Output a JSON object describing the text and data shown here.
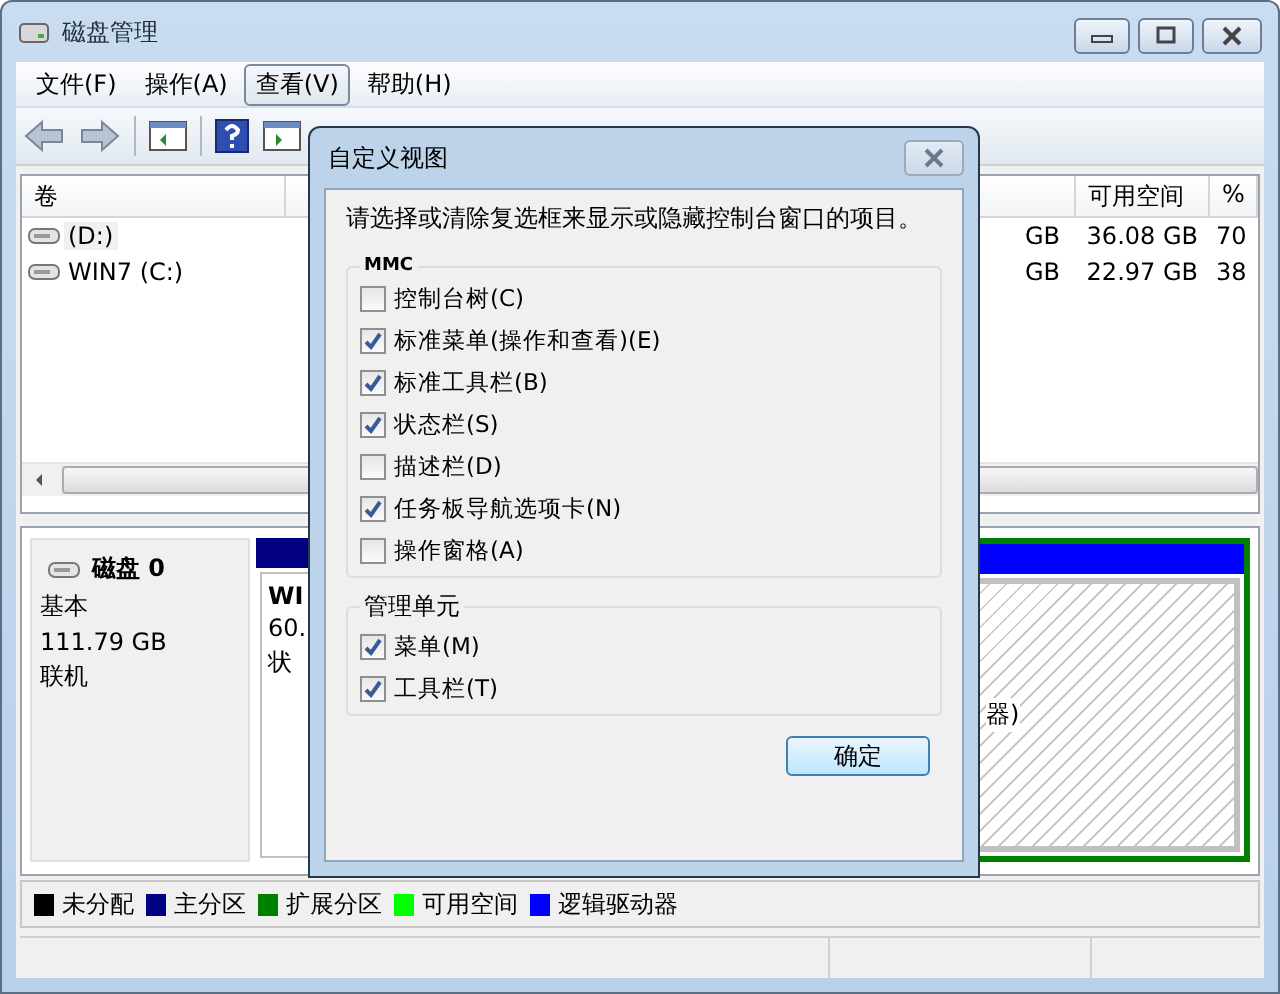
{
  "window": {
    "title": "磁盘管理"
  },
  "menu": [
    {
      "label": "文件(F)",
      "selected": false
    },
    {
      "label": "操作(A)",
      "selected": false
    },
    {
      "label": "查看(V)",
      "selected": true
    },
    {
      "label": "帮助(H)",
      "selected": false
    }
  ],
  "volume_list": {
    "columns": [
      {
        "label": "卷"
      },
      {
        "label": "可用空间"
      },
      {
        "label": "%"
      }
    ],
    "rows": [
      {
        "name": "(D:)",
        "column_3": "GB",
        "free": "36.08 GB",
        "percent": "70",
        "selected": true
      },
      {
        "name": "WIN7 (C:)",
        "column_3": "GB",
        "free": "22.97 GB",
        "percent": "38",
        "selected": false
      }
    ]
  },
  "disk": {
    "name": "磁盘 0",
    "type": "基本",
    "size": "111.79 GB",
    "status": "联机"
  },
  "partitions": [
    {
      "kind": "primary",
      "texts": [
        "WI",
        "60.",
        "状"
      ]
    },
    {
      "kind": "logical",
      "texts": [
        "器)"
      ]
    }
  ],
  "legend": [
    {
      "label": "未分配",
      "color": "#000000"
    },
    {
      "label": "主分区",
      "color": "#000080"
    },
    {
      "label": "扩展分区",
      "color": "#008000"
    },
    {
      "label": "可用空间",
      "color": "#00ff00"
    },
    {
      "label": "逻辑驱动器",
      "color": "#0000ff"
    }
  ],
  "dialog": {
    "title": "自定义视图",
    "prompt": "请选择或清除复选框来显示或隐藏控制台窗口的项目。",
    "groups": [
      {
        "title": "MMC",
        "options": [
          {
            "label": "控制台树(C)",
            "checked": false
          },
          {
            "label": "标准菜单(操作和查看)(E)",
            "checked": true
          },
          {
            "label": "标准工具栏(B)",
            "checked": true
          },
          {
            "label": "状态栏(S)",
            "checked": true
          },
          {
            "label": "描述栏(D)",
            "checked": false
          },
          {
            "label": "任务板导航选项卡(N)",
            "checked": true
          },
          {
            "label": "操作窗格(A)",
            "checked": false
          }
        ]
      },
      {
        "title": "管理单元",
        "options": [
          {
            "label": "菜单(M)",
            "checked": true
          },
          {
            "label": "工具栏(T)",
            "checked": true
          }
        ]
      }
    ],
    "ok_button": "确定"
  }
}
